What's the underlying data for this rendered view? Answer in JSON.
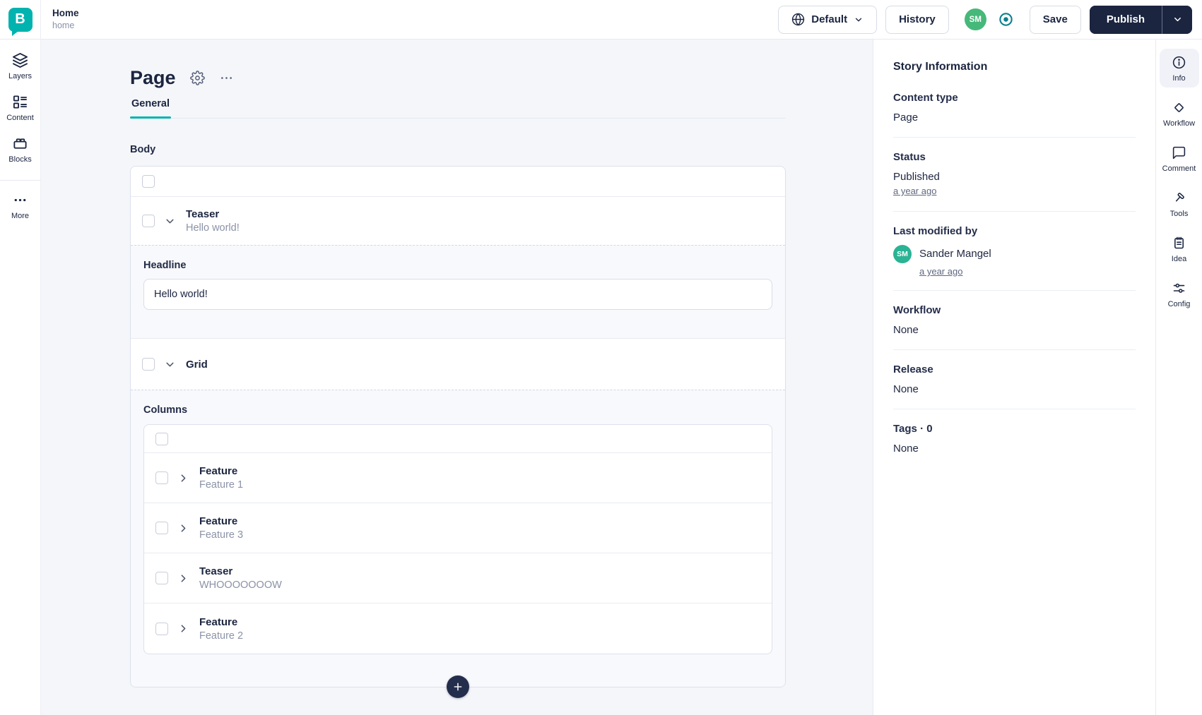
{
  "brand": {
    "logo_letter": "B"
  },
  "colors": {
    "brand_teal": "#00b3af",
    "ink_navy": "#1b2540",
    "avatar_green": "#46b87a",
    "panel_avatar_teal": "#2ab394",
    "preview_toggle_teal": "#0e7f8c",
    "tab_underline": "#00b3af"
  },
  "topbar": {
    "story_title": "Home",
    "story_slug": "home",
    "language_label": "Default",
    "history_label": "History",
    "user_initials": "SM",
    "save_label": "Save",
    "publish_label": "Publish"
  },
  "left_rail": {
    "layers_label": "Layers",
    "content_label": "Content",
    "blocks_label": "Blocks",
    "more_label": "More"
  },
  "editor": {
    "page_title": "Page",
    "general_tab": "General",
    "body_label": "Body",
    "teaser_block": {
      "title": "Teaser",
      "subtitle": "Hello world!"
    },
    "headline_field": {
      "label": "Headline",
      "value": "Hello world!"
    },
    "grid_block": {
      "title": "Grid"
    },
    "columns_label": "Columns",
    "column_blocks": [
      {
        "title": "Feature",
        "subtitle": "Feature 1"
      },
      {
        "title": "Feature",
        "subtitle": "Feature 3"
      },
      {
        "title": "Teaser",
        "subtitle": "WHOOOOOOOW"
      },
      {
        "title": "Feature",
        "subtitle": "Feature 2"
      }
    ]
  },
  "story_info": {
    "heading": "Story Information",
    "content_type": {
      "label": "Content type",
      "value": "Page"
    },
    "status": {
      "label": "Status",
      "value": "Published",
      "time_link": "a year ago"
    },
    "last_modified": {
      "label": "Last modified by",
      "user_name": "Sander Mangel",
      "user_initials": "SM",
      "time_link": "a year ago"
    },
    "workflow": {
      "label": "Workflow",
      "value": "None"
    },
    "release": {
      "label": "Release",
      "value": "None"
    },
    "tags": {
      "label": "Tags · 0",
      "value": "None"
    }
  },
  "right_rail": {
    "info_label": "Info",
    "workflow_label": "Workflow",
    "comment_label": "Comment",
    "tools_label": "Tools",
    "idea_label": "Idea",
    "config_label": "Config"
  },
  "icons": {
    "globe-icon": "language/globe",
    "chevron-down-icon": "expand chevron",
    "chevron-right-icon": "collapsed chevron",
    "preview-toggle-icon": "circle with dot",
    "gear-icon": "settings gear",
    "ellipsis-icon": "more options dots",
    "plus-icon": "add block",
    "layers-icon": "stacked layers",
    "content-icon": "content list",
    "blocks-icon": "brick block",
    "more-icon": "three dots",
    "info-icon": "info circle",
    "workflow-icon": "diamond",
    "comment-icon": "speech bubble",
    "tools-icon": "hammer",
    "idea-icon": "notepad",
    "config-icon": "sliders"
  }
}
